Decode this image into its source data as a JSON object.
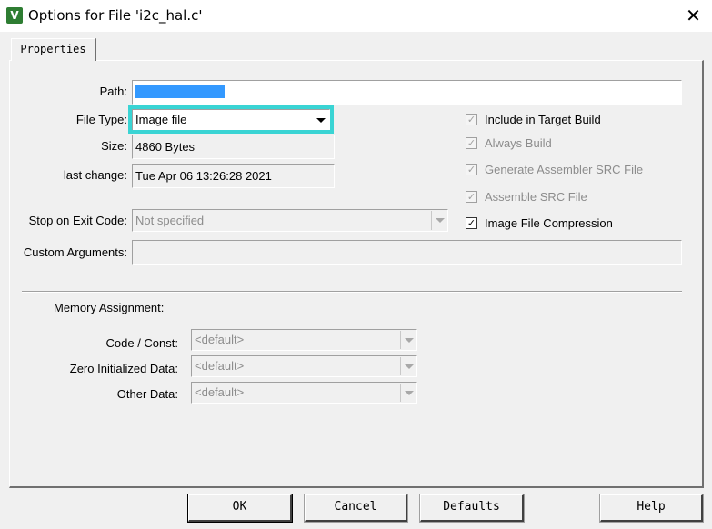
{
  "window": {
    "title": "Options for File 'i2c_hal.c'",
    "app_icon": "uvision-icon",
    "app_icon_glyph": "V",
    "close_glyph": "✕"
  },
  "tabs": [
    {
      "label": "Properties",
      "selected": true
    }
  ],
  "properties": {
    "path_label": "Path:",
    "path_value": "",
    "file_type_label": "File Type:",
    "file_type_value": "Image file",
    "size_label": "Size:",
    "size_value": "4860 Bytes",
    "last_change_label": "last change:",
    "last_change_value": "Tue Apr 06 13:26:28 2021",
    "stop_on_exit_label": "Stop on Exit Code:",
    "stop_on_exit_value": "Not specified",
    "custom_args_label": "Custom Arguments:",
    "custom_args_value": ""
  },
  "checkboxes": [
    {
      "label": "Include in Target Build",
      "checked": true,
      "enabled": false
    },
    {
      "label": "Always Build",
      "checked": true,
      "enabled": false
    },
    {
      "label": "Generate Assembler SRC File",
      "checked": true,
      "enabled": false
    },
    {
      "label": "Assemble SRC File",
      "checked": true,
      "enabled": false
    },
    {
      "label": "Image File Compression",
      "checked": true,
      "enabled": true
    }
  ],
  "memory": {
    "heading": "Memory Assignment:",
    "code_const_label": "Code / Const:",
    "code_const_value": "<default>",
    "zero_init_label": "Zero Initialized Data:",
    "zero_init_value": "<default>",
    "other_label": "Other Data:",
    "other_value": "<default>"
  },
  "buttons": {
    "ok": "OK",
    "cancel": "Cancel",
    "defaults": "Defaults",
    "help": "Help"
  },
  "colors": {
    "highlight": "#3ad4d4",
    "selection": "#3399ff",
    "window_bg": "#f0f0f0"
  }
}
